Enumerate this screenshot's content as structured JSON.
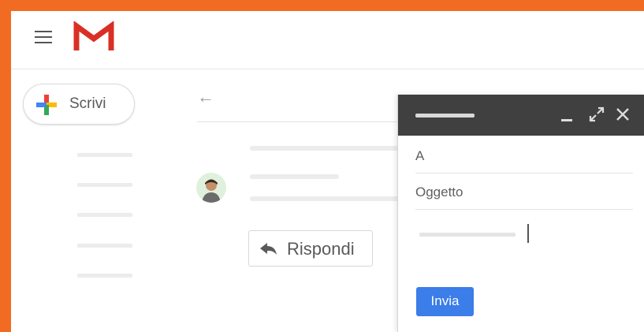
{
  "colors": {
    "frame_border": "#f26b22",
    "compose_header": "#404040",
    "send_button": "#3b7de9",
    "gmail_red": "#d93025"
  },
  "header": {
    "menu_icon": "hamburger-menu-icon",
    "logo_icon": "gmail-logo-icon"
  },
  "sidebar": {
    "compose_label": "Scrivi",
    "compose_icon": "plus-multicolor-icon"
  },
  "message": {
    "back_icon": "arrow-left-icon",
    "reply_label": "Rispondi",
    "reply_icon": "reply-arrow-icon"
  },
  "compose": {
    "to_label": "A",
    "subject_label": "Oggetto",
    "send_label": "Invia",
    "minimize_icon": "minimize-icon",
    "expand_icon": "expand-icon",
    "close_icon": "close-icon"
  }
}
